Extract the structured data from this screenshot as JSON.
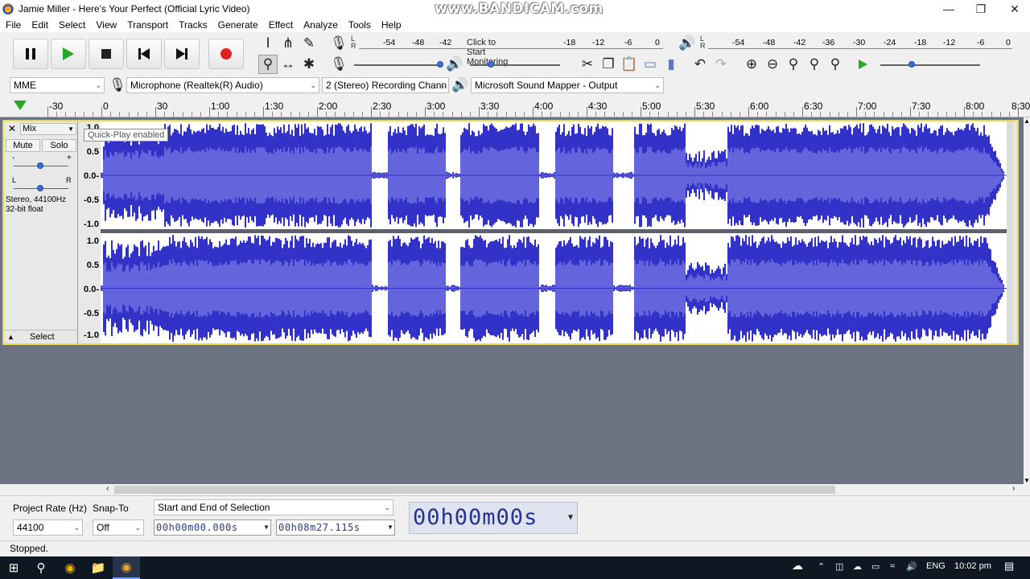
{
  "window": {
    "title": "Jamie Miller - Here's Your Perfect (Official Lyric Video)",
    "watermark": "www.BANDICAM.com"
  },
  "menu": [
    "File",
    "Edit",
    "Select",
    "View",
    "Transport",
    "Tracks",
    "Generate",
    "Effect",
    "Analyze",
    "Tools",
    "Help"
  ],
  "meters": {
    "record_ticks": [
      "-54",
      "-48",
      "-42",
      "-18",
      "-12",
      "-6",
      "0"
    ],
    "record_monitor_text": "Click to Start Monitoring",
    "play_ticks": [
      "-54",
      "-48",
      "-42",
      "-36",
      "-30",
      "-24",
      "-18",
      "-12",
      "-6",
      "0"
    ],
    "lr_label": "L\nR"
  },
  "devices": {
    "host": "MME",
    "recording_device": "Microphone (Realtek(R) Audio)",
    "channels": "2 (Stereo) Recording Chann",
    "playback_device": "Microsoft Sound Mapper - Output"
  },
  "timeline": {
    "labels": [
      "-30",
      "0",
      "30",
      "1:00",
      "1:30",
      "2:00",
      "2:30",
      "3:00",
      "3:30",
      "4:00",
      "4:30",
      "5:00",
      "5:30",
      "6:00",
      "6:30",
      "7:00",
      "7:30",
      "8:00",
      "8:30"
    ]
  },
  "track": {
    "name": "Mix",
    "mute_label": "Mute",
    "solo_label": "Solo",
    "gain_minus": "-",
    "gain_plus": "+",
    "pan_l": "L",
    "pan_r": "R",
    "format_line1": "Stereo, 44100Hz",
    "format_line2": "32-bit float",
    "select_label": "Select",
    "amplitude_ticks": [
      "1.0",
      "0.5",
      "0.0-",
      "-0.5",
      "-1.0"
    ],
    "waveform_color": "#3232c8",
    "waveform_rms_color": "#6464dc",
    "selection_border": "#e7d94e"
  },
  "tooltip": "Quick-Play enabled",
  "selection_toolbar": {
    "project_rate_label": "Project Rate (Hz)",
    "snap_to_label": "Snap-To",
    "mode": "Start and End of Selection",
    "rate_value": "44100",
    "snap_value": "Off",
    "start_time": "00h00m00.000s",
    "end_time": "00h08m27.115s",
    "audio_position": "00h00m00s"
  },
  "status": "Stopped.",
  "taskbar": {
    "language": "ENG",
    "clock": "10:02 pm"
  }
}
